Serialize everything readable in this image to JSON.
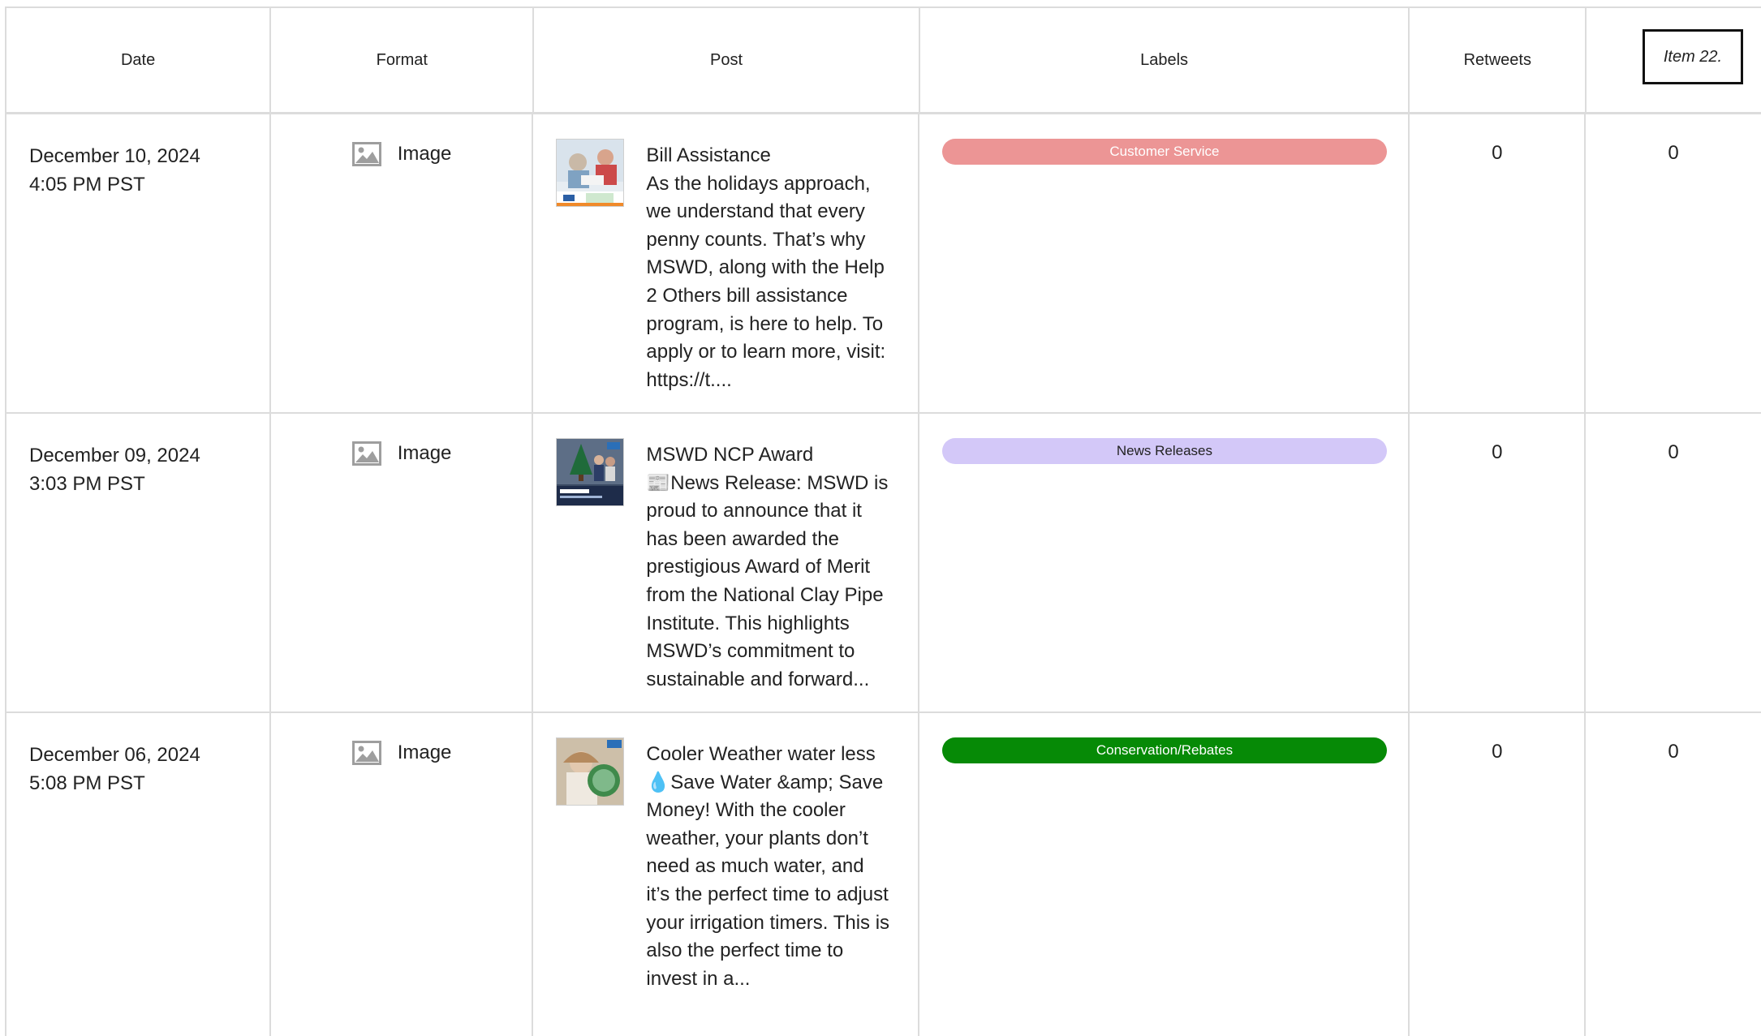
{
  "headers": {
    "date": "Date",
    "format": "Format",
    "post": "Post",
    "labels": "Labels",
    "retweets": "Retweets",
    "item_box": "Item 22."
  },
  "rows": [
    {
      "date_line1": "December 10, 2024",
      "date_line2": "4:05 PM PST",
      "format": "Image",
      "format_icon": "image-icon",
      "post_title": "Bill Assistance",
      "post_body": "As the holidays approach, we understand that every penny counts. That’s why MSWD, along with the Help 2 Others bill assistance program, is here to help. To apply or to learn more, visit: https://t....",
      "label": "Customer Service",
      "label_bg": "#ec9595",
      "label_fg": "#ffffff",
      "retweets": "0",
      "last": "0"
    },
    {
      "date_line1": "December 09, 2024",
      "date_line2": "3:03 PM PST",
      "format": "Image",
      "format_icon": "image-icon",
      "post_title": "MSWD NCP Award",
      "post_body": "📰News Release: MSWD is proud to announce that it has been awarded the prestigious Award of Merit from the National Clay Pipe Institute. This highlights MSWD’s commitment to sustainable and forward...",
      "label": "News Releases",
      "label_bg": "#d3c8f8",
      "label_fg": "#222222",
      "retweets": "0",
      "last": "0"
    },
    {
      "date_line1": "December 06, 2024",
      "date_line2": "5:08 PM PST",
      "format": "Image",
      "format_icon": "image-icon",
      "post_title": "Cooler Weather water less",
      "post_body": "💧Save Water &amp; Save Money! With the cooler weather, your plants don’t need as much water, and it’s the perfect time to adjust your irrigation timers. This is also the perfect time to invest in a...",
      "label": "Conservation/Rebates",
      "label_bg": "#068a06",
      "label_fg": "#ffffff",
      "retweets": "0",
      "last": "0"
    }
  ]
}
